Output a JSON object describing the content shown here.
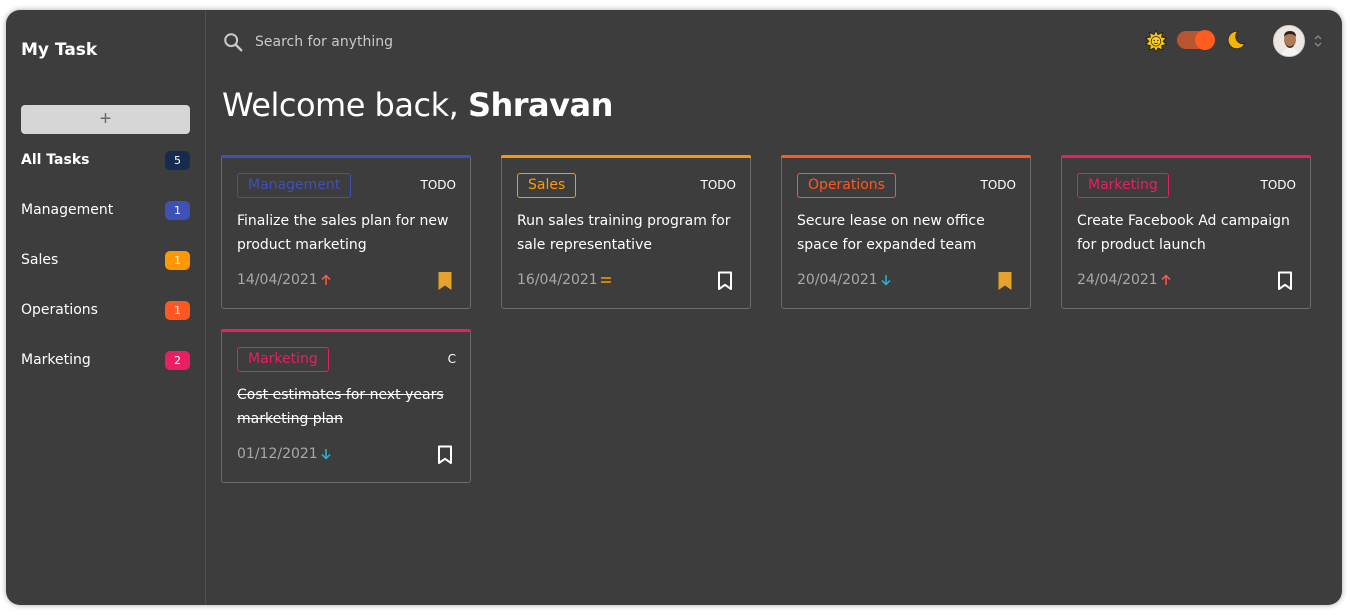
{
  "sidebar": {
    "brand": "My Task",
    "add_label": "+",
    "items": [
      {
        "label": "All Tasks",
        "count": "5",
        "color": "#172a4f"
      },
      {
        "label": "Management",
        "count": "1",
        "color": "#3f51b5"
      },
      {
        "label": "Sales",
        "count": "1",
        "color": "#ff9800"
      },
      {
        "label": "Operations",
        "count": "1",
        "color": "#ff5722"
      },
      {
        "label": "Marketing",
        "count": "2",
        "color": "#e91e63"
      }
    ]
  },
  "header": {
    "search_placeholder": "Search for anything",
    "theme_icons": {
      "light": "sun-icon",
      "dark": "moon-icon"
    },
    "theme_toggle_on": true
  },
  "welcome": {
    "prefix": "Welcome back, ",
    "name": "Shravan"
  },
  "cards": [
    {
      "tag": "Management",
      "color": "#3f51b5",
      "status": "TODO",
      "title": "Finalize the sales plan for new product marketing",
      "date": "14/04/2021",
      "priority": "up",
      "bookmarked": true,
      "done": false
    },
    {
      "tag": "Sales",
      "color": "#ff9800",
      "status": "TODO",
      "title": "Run sales training program for sale representative",
      "date": "16/04/2021",
      "priority": "equal",
      "bookmarked": false,
      "done": false
    },
    {
      "tag": "Operations",
      "color": "#ff5722",
      "status": "TODO",
      "title": "Secure lease on new office space for expanded team",
      "date": "20/04/2021",
      "priority": "down",
      "bookmarked": true,
      "done": false
    },
    {
      "tag": "Marketing",
      "color": "#e91e63",
      "status": "TODO",
      "title": "Create Facebook Ad campaign for product launch",
      "date": "24/04/2021",
      "priority": "up",
      "bookmarked": false,
      "done": false
    },
    {
      "tag": "Marketing",
      "color": "#e91e63",
      "status": "C",
      "title": "Cost estimates for next years marketing plan",
      "date": "01/12/2021",
      "priority": "down",
      "bookmarked": false,
      "done": true
    }
  ]
}
